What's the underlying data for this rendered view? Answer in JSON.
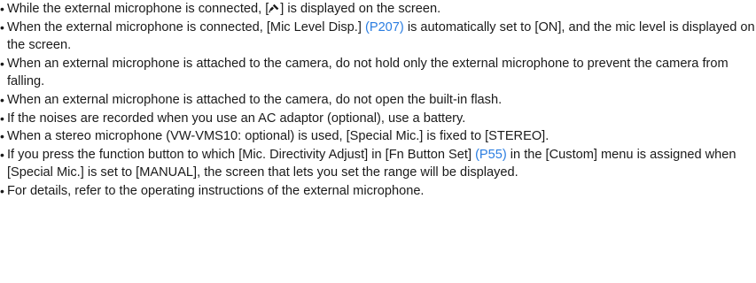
{
  "notes": [
    {
      "pre": "While the external microphone is connected, [",
      "icon": "external-mic-icon",
      "post": "] is displayed on the screen."
    },
    {
      "pre": "When the external microphone is connected, [Mic Level Disp.] ",
      "link": "(P207)",
      "post": " is automatically set to [ON], and the mic level is displayed on the screen."
    },
    {
      "text": "When an external microphone is attached to the camera, do not hold only the external microphone to prevent the camera from falling."
    },
    {
      "text": "When an external microphone is attached to the camera, do not open the built-in flash."
    },
    {
      "text": "If the noises are recorded when you use an AC adaptor (optional), use a battery."
    },
    {
      "text": "When a stereo microphone (VW-VMS10: optional) is used, [Special Mic.] is fixed to [STEREO]."
    },
    {
      "pre": "If you press the function button to which [Mic. Directivity Adjust] in [Fn Button Set] ",
      "link": "(P55)",
      "post": " in the [Custom] menu is assigned when [Special Mic.] is set to [MANUAL], the screen that lets you set the range will be displayed."
    },
    {
      "text": "For details, refer to the operating instructions of the external microphone."
    }
  ],
  "bullet_char": "•",
  "link_color": "#2a7de1"
}
